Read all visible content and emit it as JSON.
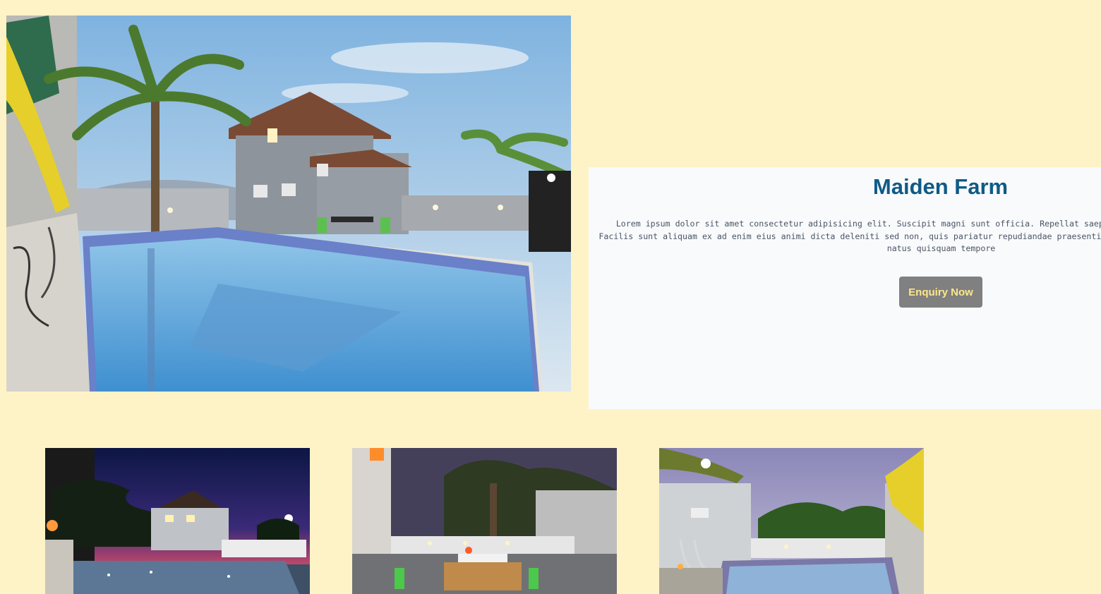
{
  "property": {
    "title": "Maiden Farm",
    "description": "Lorem ipsum dolor sit amet consectetur adipisicing elit. Suscipit magni sunt officia. Repellat saepe rerum voluptatem. Quidem, odio. Facilis sunt aliquam ex ad enim eius animi dicta deleniti sed non, quis pariatur repudiandae praesentium eveniet, laboriosam iure explicabo natus quisquam tempore",
    "button_label": "Enquiry Now"
  },
  "colors": {
    "page_background": "#fef3c7",
    "panel_background": "#f8fafc",
    "title": "#0f5a87",
    "button_background": "#808080",
    "button_text": "#fde68a"
  },
  "gallery": [
    {
      "scene": "pool-villa-dusk"
    },
    {
      "scene": "patio-night-dining"
    },
    {
      "scene": "pool-evening-garden"
    }
  ]
}
